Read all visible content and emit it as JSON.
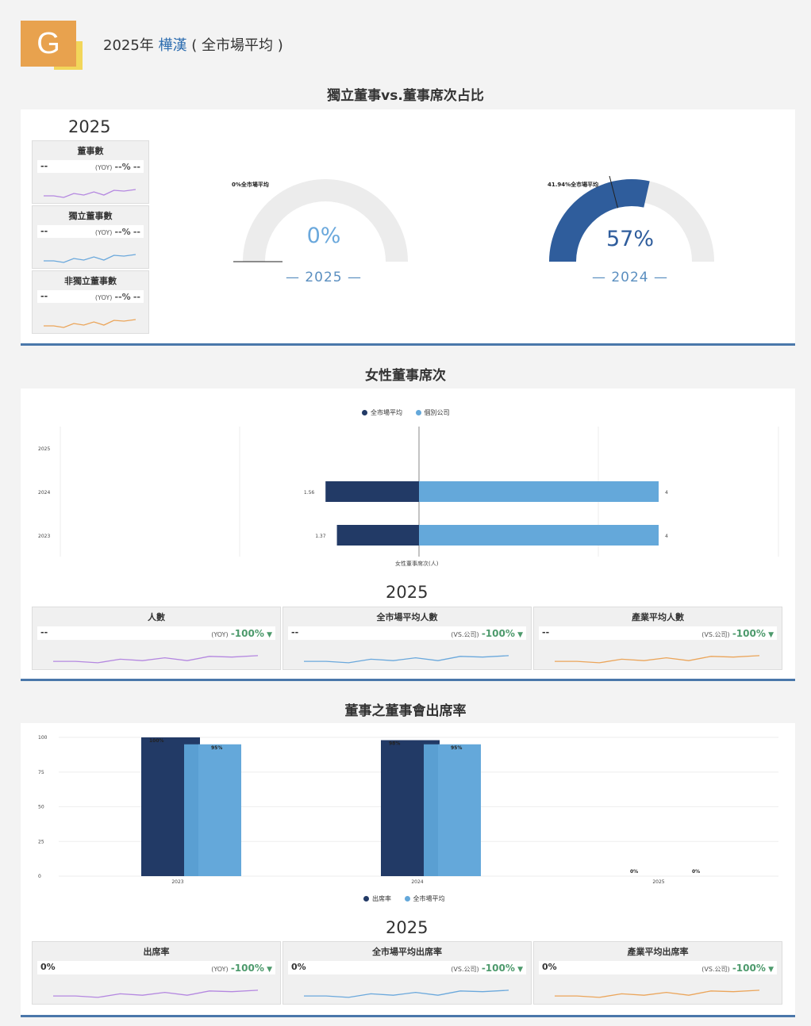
{
  "header": {
    "logo_letter": "G",
    "year_prefix": "2025年",
    "company": "樺漢",
    "suffix": "( 全市場平均 )"
  },
  "section1": {
    "title": "獨立董事vs.董事席次占比",
    "year": "2025",
    "mini_cards": [
      {
        "title": "董事數",
        "value": "--",
        "yoy": "(YOY)",
        "pct": "--%",
        "trail": "--",
        "line_color": "#b487e0"
      },
      {
        "title": "獨立董事數",
        "value": "--",
        "yoy": "(YOY)",
        "pct": "--%",
        "trail": "--",
        "line_color": "#6aa8dc"
      },
      {
        "title": "非獨立董事數",
        "value": "--",
        "yoy": "(YOY)",
        "pct": "--%",
        "trail": "--",
        "line_color": "#eba55a"
      }
    ],
    "gauges": [
      {
        "value_label": "0%",
        "value": 0,
        "year": "— 2025 —",
        "market_note": "0%全市場平均",
        "market_value": 0
      },
      {
        "value_label": "57%",
        "value": 57,
        "year": "— 2024 —",
        "market_note": "41.94%全市場平均",
        "market_value": 41.94
      }
    ]
  },
  "section2": {
    "title": "女性董事席次",
    "legend": [
      "全市場平均",
      "個別公司"
    ],
    "axis_title": "女性董事席次(人)",
    "year": "2025",
    "kpis": [
      {
        "title": "人數",
        "value": "--",
        "ref": "(YOY)",
        "change": "-100%",
        "line_color": "#b487e0"
      },
      {
        "title": "全市場平均人數",
        "value": "--",
        "ref": "(VS.公司)",
        "change": "-100%",
        "line_color": "#6aa8dc"
      },
      {
        "title": "產業平均人數",
        "value": "--",
        "ref": "(VS.公司)",
        "change": "-100%",
        "line_color": "#eba55a"
      }
    ]
  },
  "section3": {
    "title": "董事之董事會出席率",
    "legend": [
      "出席率",
      "全市場平均"
    ],
    "year": "2025",
    "kpis": [
      {
        "title": "出席率",
        "value": "0%",
        "ref": "(YOY)",
        "change": "-100%",
        "line_color": "#b487e0"
      },
      {
        "title": "全市場平均出席率",
        "value": "0%",
        "ref": "(VS.公司)",
        "change": "-100%",
        "line_color": "#6aa8dc"
      },
      {
        "title": "產業平均出席率",
        "value": "0%",
        "ref": "(VS.公司)",
        "change": "-100%",
        "line_color": "#eba55a"
      }
    ]
  },
  "colors": {
    "dark": "#223a66",
    "light": "#64a8da",
    "mid": "#5a9fd2",
    "gauge_fill": "#2f5d9c"
  },
  "chart_data": [
    {
      "type": "bar",
      "orientation": "horizontal",
      "title": "女性董事席次",
      "xlabel": "女性董事席次(人)",
      "categories": [
        "2025",
        "2024",
        "2023"
      ],
      "series": [
        {
          "name": "全市場平均",
          "values": [
            null,
            1.56,
            1.37
          ],
          "labels": [
            "",
            "1.56",
            "1.37"
          ]
        },
        {
          "name": "個別公司",
          "values": [
            null,
            4,
            4
          ],
          "labels": [
            "",
            "4",
            "4"
          ]
        }
      ],
      "legend": "top-center"
    },
    {
      "type": "bar",
      "title": "董事之董事會出席率",
      "categories": [
        "2023",
        "2024",
        "2025"
      ],
      "yticks": [
        "0",
        "25",
        "50",
        "75",
        "100"
      ],
      "ylim": [
        0,
        100
      ],
      "series": [
        {
          "name": "出席率",
          "values": [
            100,
            98,
            0
          ],
          "labels": [
            "100%",
            "98%",
            "0%"
          ]
        },
        {
          "name": "全市場平均",
          "values": [
            95,
            95,
            0
          ],
          "labels": [
            "95%",
            "95%",
            "0%"
          ]
        }
      ],
      "legend": "bottom-center",
      "grid": true
    }
  ]
}
